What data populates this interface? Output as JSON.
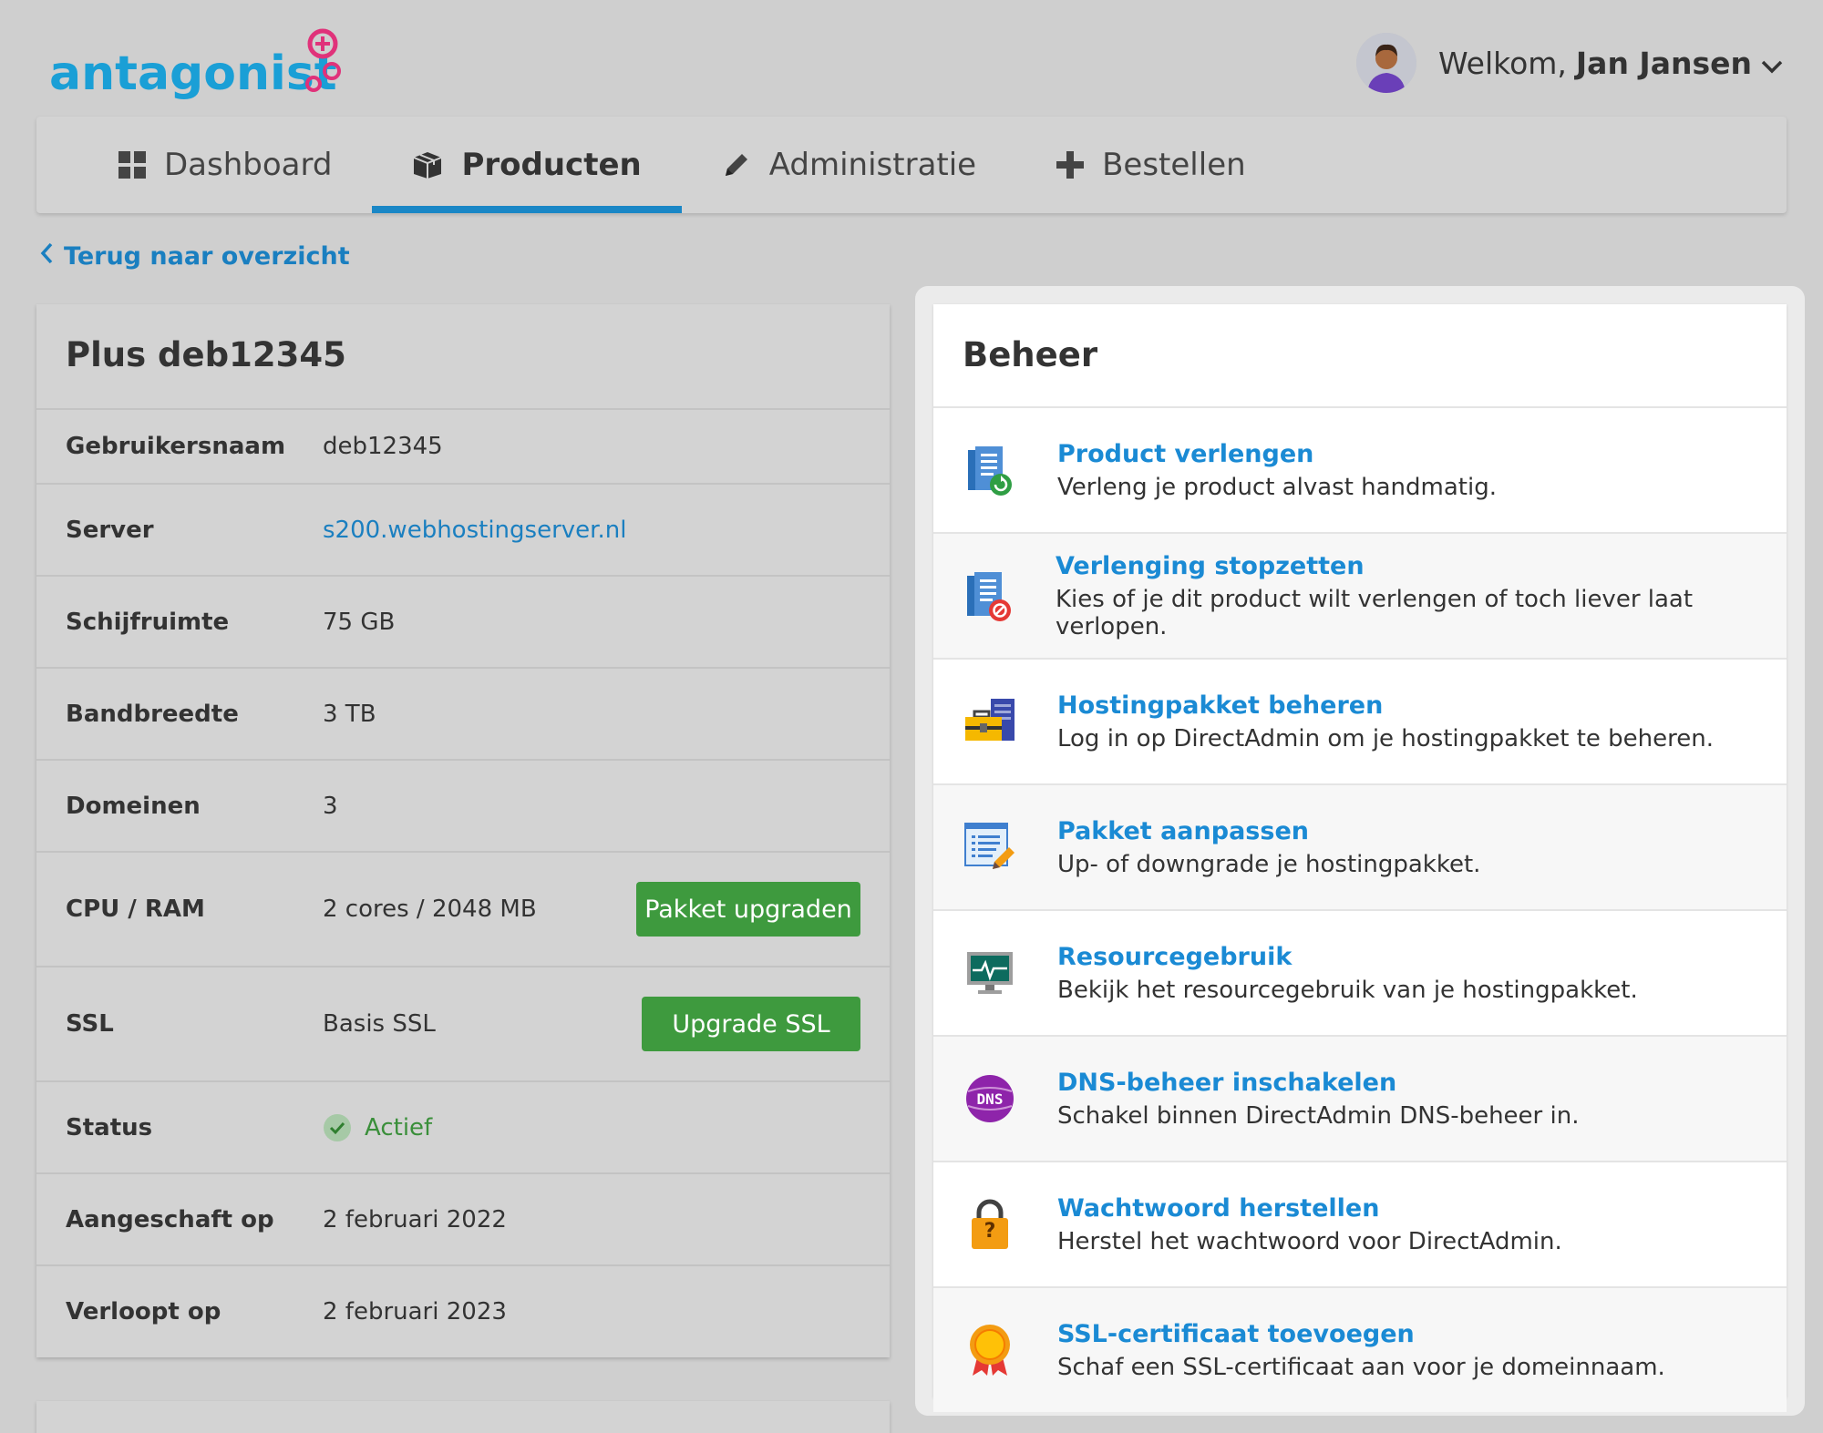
{
  "header": {
    "logo_text": "antagonist",
    "welcome_prefix": "Welkom,",
    "user_name": "Jan Jansen"
  },
  "nav": {
    "items": [
      {
        "label": "Dashboard",
        "icon": "grid-icon"
      },
      {
        "label": "Producten",
        "icon": "box-icon",
        "active": true
      },
      {
        "label": "Administratie",
        "icon": "pencil-icon"
      },
      {
        "label": "Bestellen",
        "icon": "plus-icon"
      }
    ]
  },
  "back_link": "Terug naar overzicht",
  "product": {
    "title": "Plus deb12345",
    "rows": [
      {
        "label": "Gebruikersnaam",
        "value": "deb12345"
      },
      {
        "label": "Server",
        "value": "s200.webhostingserver.nl"
      },
      {
        "label": "Schijfruimte",
        "value": "75 GB"
      },
      {
        "label": "Bandbreedte",
        "value": "3 TB"
      },
      {
        "label": "Domeinen",
        "value": "3"
      },
      {
        "label": "CPU / RAM",
        "value": "2 cores / 2048 MB",
        "button": "Pakket upgraden"
      },
      {
        "label": "SSL",
        "value": "Basis SSL",
        "button": "Upgrade SSL"
      },
      {
        "label": "Status",
        "value": "Actief"
      },
      {
        "label": "Aangeschaft op",
        "value": "2 februari 2022"
      },
      {
        "label": "Verloopt op",
        "value": "2 februari 2023"
      }
    ]
  },
  "beheer": {
    "title": "Beheer",
    "actions": [
      {
        "title": "Product verlengen",
        "desc": "Verleng je product alvast handmatig.",
        "icon": "renew-document-icon"
      },
      {
        "title": "Verlenging stopzetten",
        "desc": "Kies of je dit product wilt verlengen of toch liever laat verlopen.",
        "icon": "stop-renewal-icon"
      },
      {
        "title": "Hostingpakket beheren",
        "desc": "Log in op DirectAdmin om je hostingpakket te beheren.",
        "icon": "toolbox-server-icon"
      },
      {
        "title": "Pakket aanpassen",
        "desc": "Up- of downgrade je hostingpakket.",
        "icon": "edit-document-icon"
      },
      {
        "title": "Resourcegebruik",
        "desc": "Bekijk het resourcegebruik van je hostingpakket.",
        "icon": "monitor-pulse-icon"
      },
      {
        "title": "DNS-beheer inschakelen",
        "desc": "Schakel binnen DirectAdmin DNS-beheer in.",
        "icon": "dns-icon",
        "icon_text": "DNS"
      },
      {
        "title": "Wachtwoord herstellen",
        "desc": "Herstel het wachtwoord voor DirectAdmin.",
        "icon": "padlock-question-icon",
        "icon_text": "?"
      },
      {
        "title": "SSL-certificaat toevoegen",
        "desc": "Schaf een SSL-certificaat aan voor je domeinnaam.",
        "icon": "certificate-badge-icon"
      }
    ]
  },
  "colors": {
    "accent": "#1a87c6",
    "link": "#1a8ad4",
    "green_button": "#3e9a3e",
    "status_green": "#3a8f3a"
  }
}
